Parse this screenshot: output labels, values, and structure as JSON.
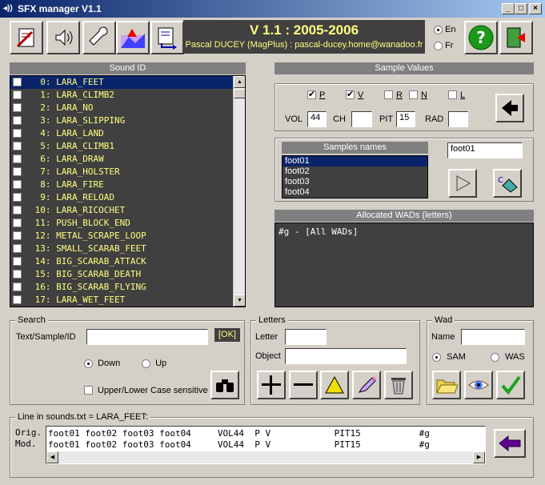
{
  "window": {
    "title": "SFX manager V1.1"
  },
  "header": {
    "version": "V 1.1 : 2005-2006",
    "author": "Pascal DUCEY (MagPlus) : pascal-ducey.home@wanadoo.fr"
  },
  "language": {
    "en": "En",
    "fr": "Fr"
  },
  "sound_id": {
    "title": "Sound ID",
    "items": [
      "  0: LARA_FEET",
      "  1: LARA_CLIMB2",
      "  2: LARA_NO",
      "  3: LARA_SLIPPING",
      "  4: LARA_LAND",
      "  5: LARA_CLIMB1",
      "  6: LARA_DRAW",
      "  7: LARA_HOLSTER",
      "  8: LARA_FIRE",
      "  9: LARA_RELOAD",
      " 10: LARA_RICOCHET",
      " 11: PUSH_BLOCK_END",
      " 12: METAL_SCRAPE_LOOP",
      " 13: SMALL_SCARAB_FEET",
      " 14: BIG_SCARAB_ATTACK",
      " 15: BIG_SCARAB_DEATH",
      " 16: BIG_SCARAB_FLYING",
      " 17: LARA_WET_FEET"
    ]
  },
  "sample_values": {
    "title": "Sample Values",
    "flags": [
      "P",
      "V",
      "R",
      "N",
      "L"
    ],
    "vol_label": "VOL",
    "vol": "44",
    "ch_label": "CH",
    "ch": "",
    "pit_label": "PIT",
    "pit": "15",
    "rad_label": "RAD",
    "rad": ""
  },
  "samples": {
    "title": "Samples names",
    "items": [
      "foot01",
      "foot02",
      "foot03",
      "foot04"
    ],
    "current": "foot01"
  },
  "wads": {
    "title": "Allocated WADs (letters)",
    "content": "#g - [All WADs]"
  },
  "search": {
    "title": "Search",
    "label": "Text/Sample/ID",
    "value": "",
    "ok": "[OK]",
    "down": "Down",
    "up": "Up",
    "case": "Upper/Lower Case sensitive"
  },
  "letters": {
    "title": "Letters",
    "letter_label": "Letter",
    "letter": "",
    "object_label": "Object",
    "object": ""
  },
  "wad": {
    "title": "Wad",
    "name_label": "Name",
    "name": "",
    "sam": "SAM",
    "was": "WAS"
  },
  "line": {
    "title": "Line in sounds.txt = LARA_FEET:",
    "orig_label": "Orig.",
    "mod_label": "Mod.",
    "orig": "foot01 foot02 foot03 foot04     VOL44  P V            PIT15           #g",
    "mod": "foot01 foot02 foot03 foot04     VOL44  P V            PIT15           #g"
  }
}
